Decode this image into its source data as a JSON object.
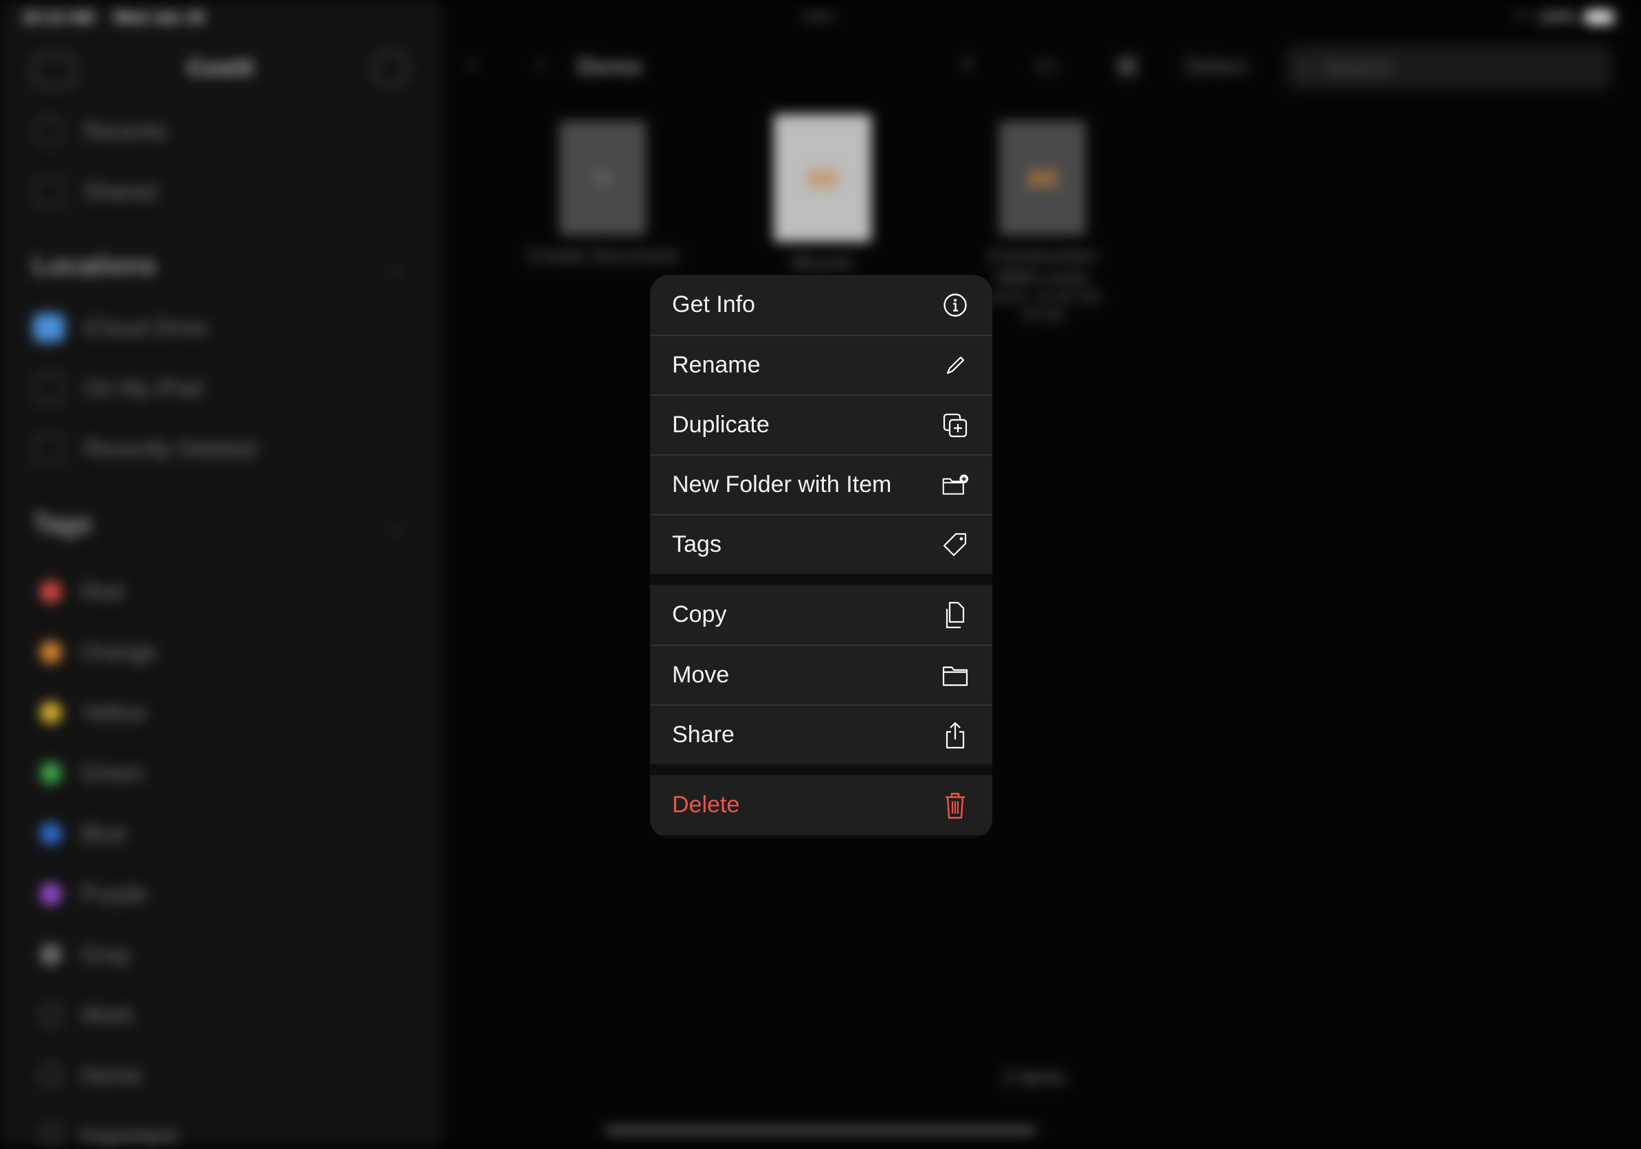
{
  "status_bar": {
    "time": "10:12 AM",
    "date": "Wed Jan 18",
    "battery": "100%"
  },
  "sidebar": {
    "title": "CostX",
    "top_items": [
      {
        "label": "Recents",
        "icon": "clock-icon"
      },
      {
        "label": "Shared",
        "icon": "shared-folder-icon"
      }
    ],
    "locations": {
      "header": "Locations",
      "items": [
        {
          "label": "iCloud Drive",
          "icon": "icloud-icon"
        },
        {
          "label": "On My iPad",
          "icon": "ipad-icon"
        },
        {
          "label": "Recently Deleted",
          "icon": "trash-icon"
        }
      ]
    },
    "tags": {
      "header": "Tags",
      "items": [
        {
          "label": "Red",
          "color": "#d84a3f"
        },
        {
          "label": "Orange",
          "color": "#d9892f"
        },
        {
          "label": "Yellow",
          "color": "#d8b530"
        },
        {
          "label": "Green",
          "color": "#3fa84a"
        },
        {
          "label": "Blue",
          "color": "#2f6fd8"
        },
        {
          "label": "Purple",
          "color": "#9a4ad0"
        },
        {
          "label": "Gray",
          "color": "#6a6a6a"
        },
        {
          "label": "Work",
          "color": ""
        },
        {
          "label": "Home",
          "color": ""
        },
        {
          "label": "Important",
          "color": ""
        }
      ]
    }
  },
  "toolbar": {
    "folder_title": "Demo",
    "select_label": "Select",
    "search_placeholder": "Search"
  },
  "files": [
    {
      "name": "Create Document"
    },
    {
      "name": "Bicycle"
    },
    {
      "name": "Construction WBS.costx",
      "meta": "1/4/23, 10:46 PM",
      "size": "59 KB"
    }
  ],
  "items_count": "2 items",
  "context_menu": {
    "groups": [
      [
        {
          "label": "Get Info",
          "icon": "info-icon"
        },
        {
          "label": "Rename",
          "icon": "pencil-icon"
        },
        {
          "label": "Duplicate",
          "icon": "duplicate-icon"
        },
        {
          "label": "New Folder with Item",
          "icon": "new-folder-icon"
        },
        {
          "label": "Tags",
          "icon": "tag-icon"
        }
      ],
      [
        {
          "label": "Copy",
          "icon": "copy-icon"
        },
        {
          "label": "Move",
          "icon": "folder-icon"
        },
        {
          "label": "Share",
          "icon": "share-icon"
        }
      ],
      [
        {
          "label": "Delete",
          "icon": "trash-icon",
          "color": "#eb5545"
        }
      ]
    ]
  }
}
